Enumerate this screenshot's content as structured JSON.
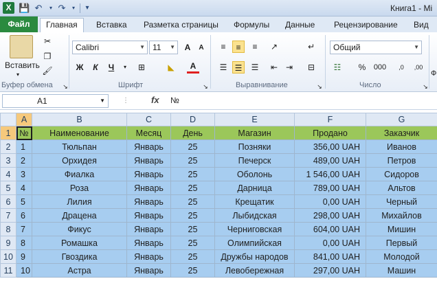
{
  "window": {
    "title": "Книга1 - Mi"
  },
  "tabs": {
    "file": "Файл",
    "items": [
      "Главная",
      "Вставка",
      "Разметка страницы",
      "Формулы",
      "Данные",
      "Рецензирование",
      "Вид"
    ],
    "active_index": 0
  },
  "ribbon": {
    "clipboard": {
      "paste_label": "Вставить",
      "group_label": "Буфер обмена"
    },
    "font": {
      "font_name": "Calibri",
      "font_size": "11",
      "bold": "Ж",
      "italic": "К",
      "underline": "Ч",
      "grow": "A",
      "shrink": "A",
      "color_letter": "A",
      "group_label": "Шрифт"
    },
    "alignment": {
      "group_label": "Выравнивание"
    },
    "number": {
      "format": "Общий",
      "percent": "%",
      "thousands": "000",
      "dec_inc": ",0",
      "dec_dec": ",00",
      "group_label": "Число"
    },
    "cut_label": "Ф"
  },
  "formula_bar": {
    "name_box": "A1",
    "fx": "fx",
    "content": "№"
  },
  "sheet": {
    "columns": [
      "A",
      "B",
      "C",
      "D",
      "E",
      "F",
      "G"
    ],
    "header": [
      "№",
      "Наименование",
      "Месяц",
      "День",
      "Магазин",
      "Продано",
      "Заказчик"
    ],
    "rows": [
      [
        "1",
        "Тюльпан",
        "Январь",
        "25",
        "Позняки",
        "356,00 UAH",
        "Иванов"
      ],
      [
        "2",
        "Орхидея",
        "Январь",
        "25",
        "Печерск",
        "489,00 UAH",
        "Петров"
      ],
      [
        "3",
        "Фиалка",
        "Январь",
        "25",
        "Оболонь",
        "1 546,00 UAH",
        "Сидоров"
      ],
      [
        "4",
        "Роза",
        "Январь",
        "25",
        "Дарница",
        "789,00 UAH",
        "Альтов"
      ],
      [
        "5",
        "Лилия",
        "Январь",
        "25",
        "Крещатик",
        "0,00 UAH",
        "Черный"
      ],
      [
        "6",
        "Драцена",
        "Январь",
        "25",
        "Лыбидская",
        "298,00 UAH",
        "Михайлов"
      ],
      [
        "7",
        "Фикус",
        "Январь",
        "25",
        "Черниговская",
        "604,00 UAH",
        "Мишин"
      ],
      [
        "8",
        "Ромашка",
        "Январь",
        "25",
        "Олимпийская",
        "0,00 UAH",
        "Первый"
      ],
      [
        "9",
        "Гвоздика",
        "Январь",
        "25",
        "Дружбы народов",
        "841,00 UAH",
        "Молодой"
      ],
      [
        "10",
        "Астра",
        "Январь",
        "25",
        "Левобережная",
        "297,00 UAH",
        "Машин"
      ]
    ],
    "row_numbers": [
      "1",
      "2",
      "3",
      "4",
      "5",
      "6",
      "7",
      "8",
      "9",
      "10",
      "11"
    ]
  },
  "colors": {
    "header_fill": "#9bc75a",
    "data_fill": "#a7cdf0",
    "selection_header": "#f6c97c"
  }
}
